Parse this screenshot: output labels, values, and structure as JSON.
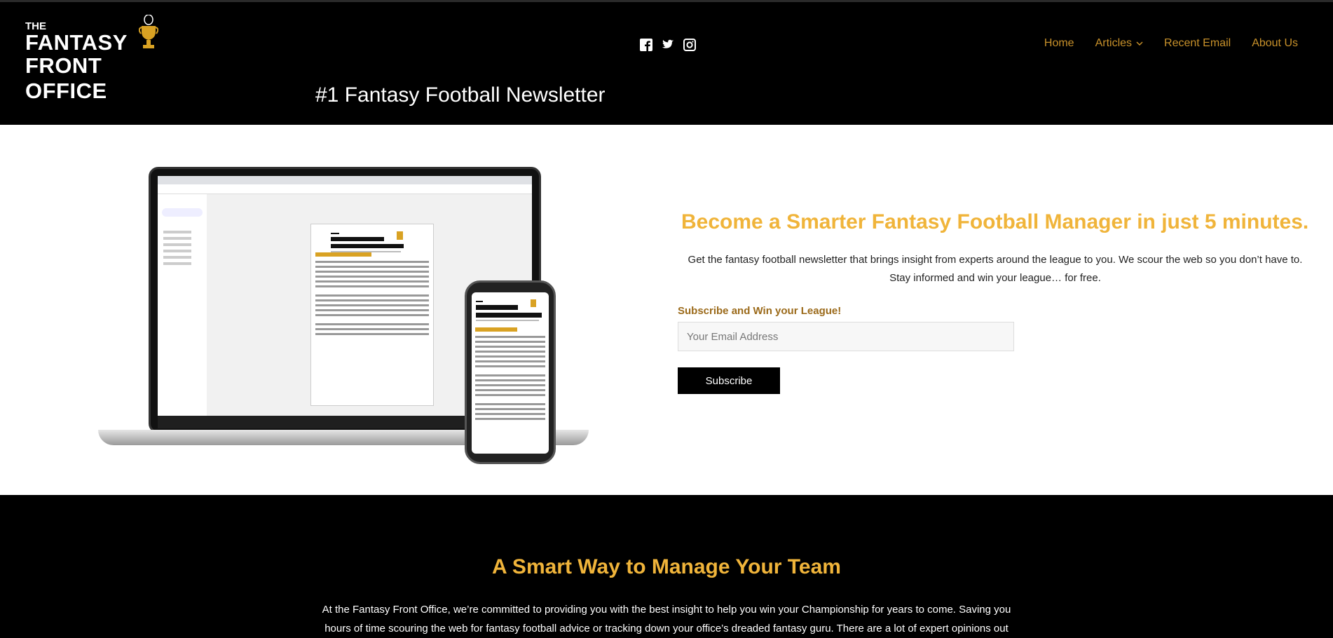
{
  "brand": {
    "logo_line0": "THE",
    "logo_line1": "FANTASY",
    "logo_line2": "FRONT OFFICE",
    "tagline": "#1 Fantasy Football Newsletter",
    "accent": "#f0b43a",
    "nav_color": "#c8912a"
  },
  "social": [
    {
      "icon": "facebook-icon"
    },
    {
      "icon": "twitter-icon"
    },
    {
      "icon": "instagram-icon"
    }
  ],
  "nav": {
    "home": "Home",
    "articles": "Articles",
    "recent_email": "Recent Email",
    "about": "About Us"
  },
  "hero": {
    "title": "Become a Smarter Fantasy Football Manager in just 5 minutes.",
    "para1": "Get the fantasy football newsletter that brings insight from experts around the league to you. We scour the web so you don’t have to.",
    "para2": "Stay informed and win your league… for free.",
    "subscribe_label": "Subscribe and Win your League!",
    "email_placeholder": "Your Email Address",
    "subscribe_button": "Subscribe"
  },
  "section2": {
    "title": "A Smart Way to Manage Your Team",
    "para": "At the Fantasy Front Office, we’re committed to providing you with the best insight to help you win your Championship for years to come. Saving you hours of time scouring the web for fantasy football advice or tracking down your office’s dreaded fantasy guru. There are a lot of expert opinions out"
  }
}
